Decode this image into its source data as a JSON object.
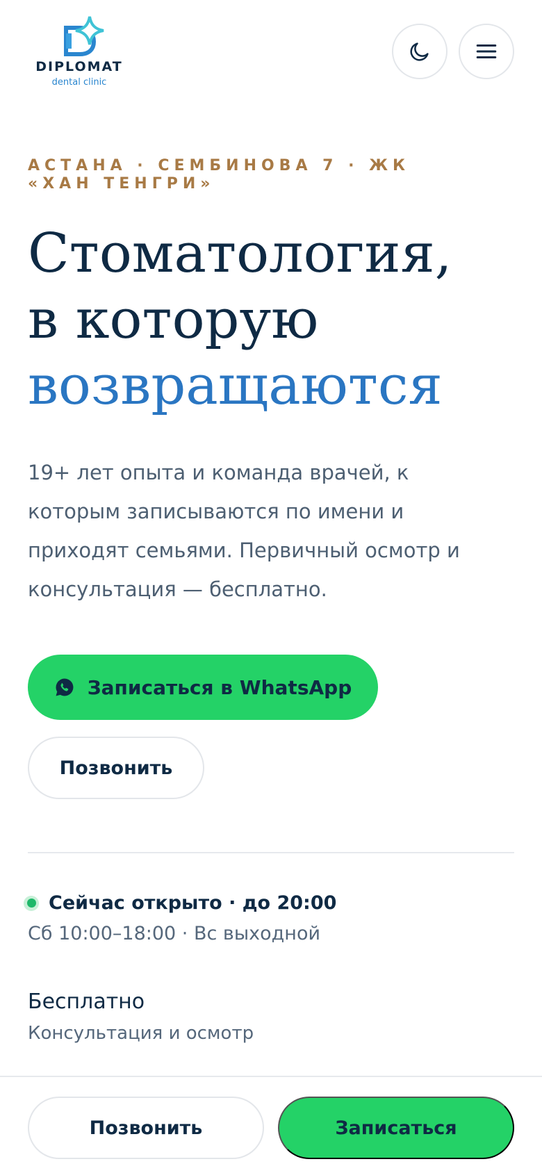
{
  "brand": {
    "name": "DIPLOMAT",
    "subtitle": "dental clinic",
    "colors": {
      "primary": "#0f2a44",
      "accent_blue": "#2a76c2",
      "accent_gold": "#a87a45",
      "whatsapp_green": "#24d267"
    }
  },
  "header": {
    "theme_toggle_icon": "moon-icon",
    "menu_icon": "hamburger-menu-icon"
  },
  "hero": {
    "eyebrow_line1": "АСТАНА · СЕМБИНОВА 7 · ЖК",
    "eyebrow_line2": "«ХАН ТЕНГРИ»",
    "headline_line1": "Стоматология,",
    "headline_line2": "в которую",
    "headline_accent": "возвращаются",
    "lead": "19+ лет опыта и команда врачей, к которым записываются по имени и приходят семьями. Первичный осмотр и консультация — бесплатно."
  },
  "cta": {
    "whatsapp_label": "Записаться в WhatsApp",
    "whatsapp_icon": "whatsapp-icon",
    "call_label": "Позвонить"
  },
  "status": {
    "open_text": "Сейчас открыто · до 20:00",
    "hours_text": "Сб 10:00–18:00 · Вс выходной"
  },
  "offer": {
    "title": "Бесплатно",
    "subtitle": "Консультация и осмотр"
  },
  "bottom_bar": {
    "call_label": "Позвонить",
    "book_label": "Записаться"
  }
}
